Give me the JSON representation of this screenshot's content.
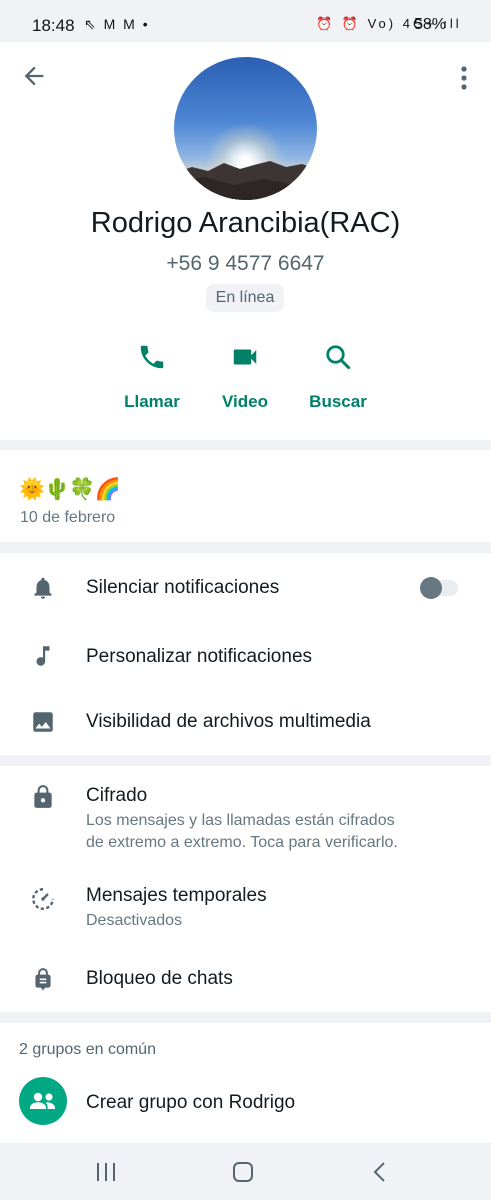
{
  "status_bar": {
    "time": "18:48",
    "notification_icons": [
      "missed-call-icon",
      "gmail-icon",
      "gmail-icon",
      "dot-icon"
    ],
    "left_icons_text": "⇖ M M •",
    "right_icons": [
      "alarm-icon",
      "alarm-clock-icon",
      "volte-icon",
      "4g-plus-icon",
      "signal-icon"
    ],
    "right_icons_text": "⏰ ⏰ Vo) 4G+ ıll",
    "battery": "58%"
  },
  "profile": {
    "name": "Rodrigo Arancibia(RAC)",
    "phone": "+56 9 4577 6647",
    "status": "En línea",
    "actions": [
      {
        "label": "Llamar",
        "icon": "phone-icon"
      },
      {
        "label": "Video",
        "icon": "video-icon"
      },
      {
        "label": "Buscar",
        "icon": "search-icon"
      }
    ]
  },
  "about": {
    "emoji": "🌞🌵🍀🌈",
    "date": "10 de febrero"
  },
  "settings": {
    "mute": {
      "label": "Silenciar notificaciones",
      "enabled": false
    },
    "custom": {
      "label": "Personalizar notificaciones"
    },
    "media": {
      "label": "Visibilidad de archivos multimedia"
    }
  },
  "security": {
    "encryption": {
      "title": "Cifrado",
      "line1": "Los mensajes y las llamadas están cifrados",
      "line2": "de extremo a extremo. Toca para verificarlo."
    },
    "disappearing": {
      "title": "Mensajes temporales",
      "value": "Desactivados"
    },
    "chat_lock": {
      "title": "Bloqueo de chats"
    }
  },
  "groups": {
    "count_label": "2 grupos en común",
    "create_label": "Crear grupo con Rodrigo"
  },
  "colors": {
    "accent": "#008069",
    "accent_bg": "#00a884",
    "icon_gray": "#54656f",
    "background": "#f0f2f5"
  }
}
